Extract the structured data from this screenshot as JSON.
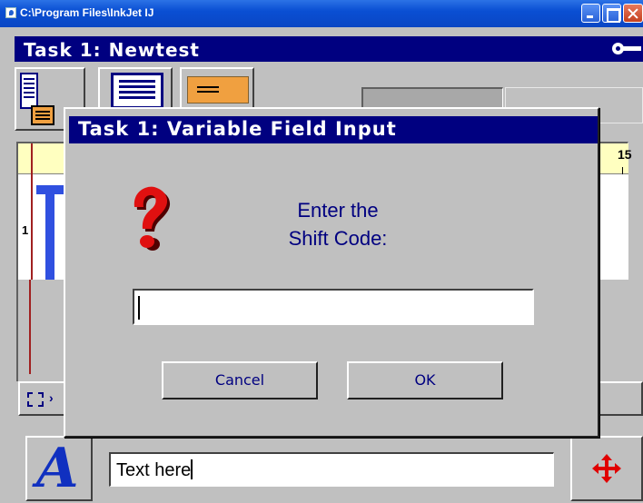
{
  "window": {
    "title": "C:\\Program Files\\InkJet  IJ",
    "icons": [
      "app-icon",
      "minimize-icon",
      "maximize-icon",
      "close-icon"
    ]
  },
  "app": {
    "task_title": "Task 1: Newtest",
    "key_icon": "key-icon"
  },
  "ruler": {
    "number": "15"
  },
  "editor": {
    "row_number": "1"
  },
  "dialog": {
    "title": "Task 1: Variable Field Input",
    "prompt_line1": "Enter the",
    "prompt_line2": "Shift Code:",
    "input_value": "",
    "cancel_label": "Cancel",
    "ok_label": "OK",
    "icon": "question-icon"
  },
  "bottom": {
    "font_glyph": "A",
    "text_value": "Text here",
    "move_icon": "move-arrows-icon"
  },
  "colors": {
    "titlebar": "#0a4fd3",
    "navy": "#000080",
    "face": "#c0c0c0",
    "question_red": "#e01010",
    "move_red": "#e00000"
  }
}
